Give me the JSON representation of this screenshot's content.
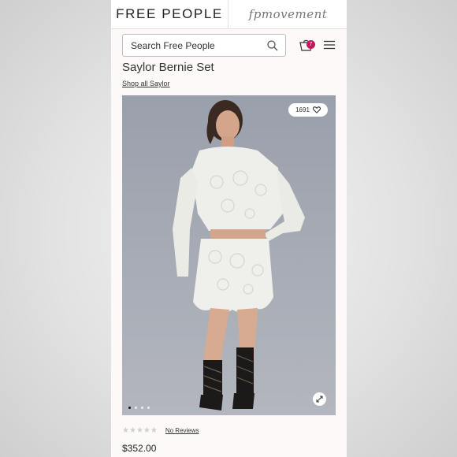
{
  "header": {
    "brand_left": "FREE PEOPLE",
    "brand_right": "fpmovement"
  },
  "search": {
    "placeholder": "Search Free People"
  },
  "cart": {
    "count": "7",
    "badge_color": "#c2185b"
  },
  "product": {
    "title": "Saylor Bernie Set",
    "shop_all_label": "Shop all Saylor",
    "likes": "1691",
    "carousel": {
      "total": 4,
      "active_index": 0
    },
    "rating": {
      "stars": 0,
      "max": 5
    },
    "reviews_label": "No Reviews",
    "price": "$352.00"
  },
  "icons": [
    "search-icon",
    "cart-icon",
    "menu-icon",
    "heart-icon",
    "expand-icon",
    "star-icon"
  ]
}
